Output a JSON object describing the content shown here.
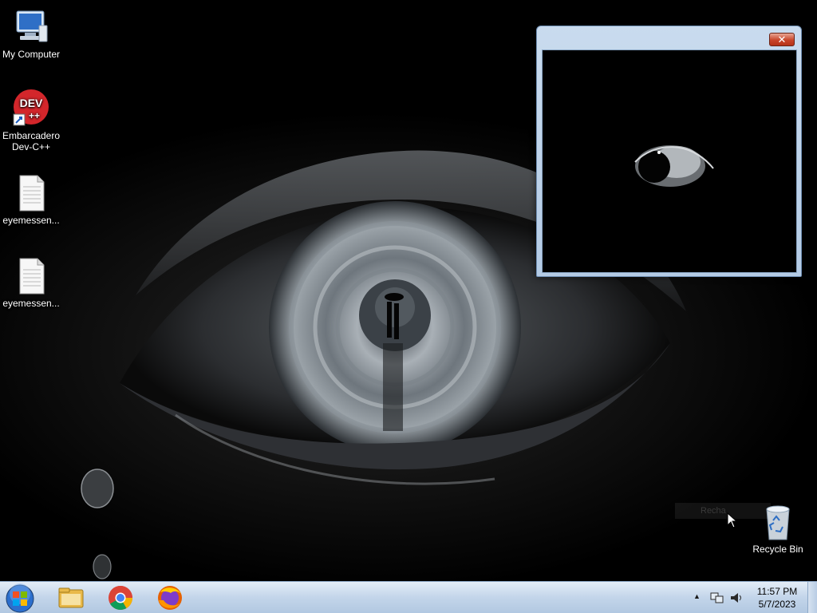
{
  "desktop": {
    "icons": [
      {
        "label": "My Computer"
      },
      {
        "label": "Embarcadero Dev-C++"
      },
      {
        "label": "eyemessen..."
      },
      {
        "label": "eyemessen..."
      },
      {
        "label": "Recycle Bin"
      }
    ],
    "dev_badge": "DEV"
  },
  "window": {
    "title": "",
    "close_glyph": "✕"
  },
  "tooltip": {
    "text": "Recha"
  },
  "taskbar": {
    "pinned": [
      {
        "name": "windows-explorer",
        "icon": "folder-icon"
      },
      {
        "name": "google-chrome",
        "icon": "chrome-icon"
      },
      {
        "name": "firefox",
        "icon": "firefox-icon"
      }
    ],
    "tray": {
      "time": "11:57 PM",
      "date": "5/7/2023",
      "chevron": "▲"
    }
  },
  "colors": {
    "taskbar": "#c3d5ea",
    "window_frame": "#b4cbe5",
    "close_button": "#c8452a",
    "wallpaper": "#000000"
  }
}
